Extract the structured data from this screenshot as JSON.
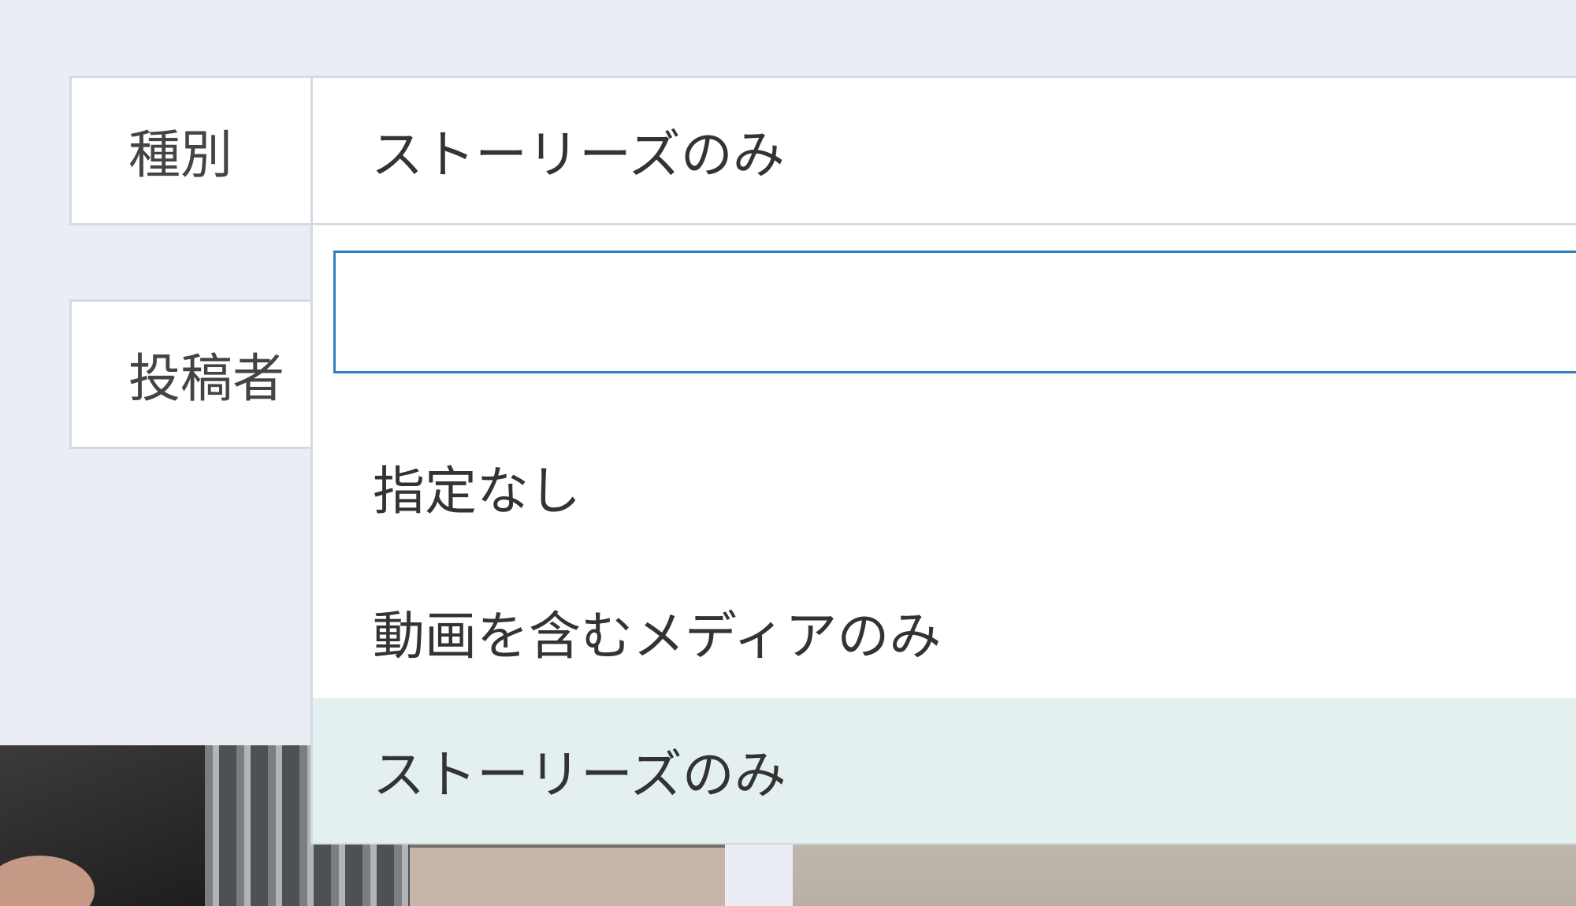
{
  "filters": {
    "type": {
      "label": "種別",
      "selected_value": "ストーリーズのみ"
    },
    "poster": {
      "label": "投稿者"
    }
  },
  "dropdown": {
    "search_value": "",
    "options": [
      {
        "label": "指定なし",
        "selected": false
      },
      {
        "label": "動画を含むメディアのみ",
        "selected": false
      },
      {
        "label": "ストーリーズのみ",
        "selected": true
      }
    ]
  },
  "colors": {
    "background": "#eaeef4",
    "border": "#d3dae3",
    "focus_border": "#2f7fc1",
    "selected_option_bg": "#e4f0f0"
  }
}
